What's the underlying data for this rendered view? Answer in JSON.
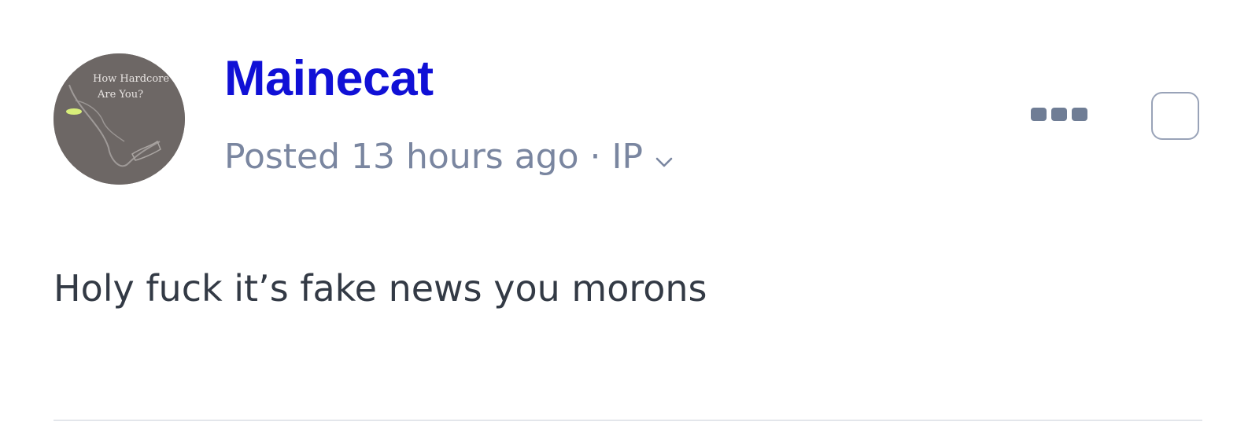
{
  "post": {
    "author": "Mainecat",
    "posted_label": "Posted 13 hours ago",
    "separator": "·",
    "source_label": "IP",
    "body": "Holy fuck it’s fake news you morons",
    "avatar_text_line1": "How Hardcore",
    "avatar_text_line2": "Are You?"
  },
  "icons": {
    "more": "more-options-icon",
    "expand": "chevron-down-icon",
    "select": "checkbox-icon"
  },
  "colors": {
    "author": "#1010d6",
    "meta": "#7a86a0",
    "body": "#333a45",
    "more_dots": "#6f7d95",
    "checkbox_border": "#99a3b8",
    "divider": "#e3e6eb"
  }
}
